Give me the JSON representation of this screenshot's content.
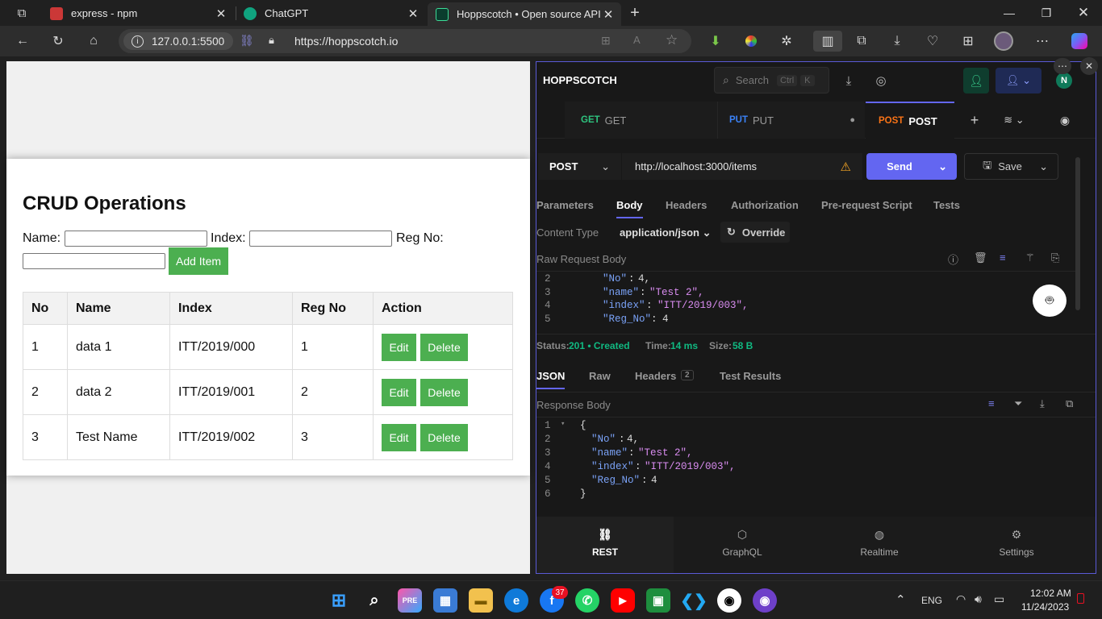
{
  "browser": {
    "tabs": [
      {
        "title": "express - npm"
      },
      {
        "title": "ChatGPT"
      },
      {
        "title": "Hoppscotch • Open source API d"
      }
    ],
    "local_address": "127.0.0.1:5500",
    "url": "https://hoppscotch.io"
  },
  "app": {
    "title": "CRUD Operations",
    "name_label": "Name:",
    "index_label": "Index:",
    "regno_label": "Reg No:",
    "add_button": "Add Item",
    "columns": [
      "No",
      "Name",
      "Index",
      "Reg No",
      "Action"
    ],
    "rows": [
      {
        "no": "1",
        "name": "data 1",
        "index": "ITT/2019/000",
        "reg": "1"
      },
      {
        "no": "2",
        "name": "data 2",
        "index": "ITT/2019/001",
        "reg": "2"
      },
      {
        "no": "3",
        "name": "Test Name",
        "index": "ITT/2019/002",
        "reg": "3"
      }
    ],
    "edit_label": "Edit",
    "delete_label": "Delete"
  },
  "hoppscotch": {
    "brand": "HOPPSCOTCH",
    "search_placeholder": "Search",
    "kbd1": "Ctrl",
    "kbd2": "K",
    "avatar": "N",
    "tabs": [
      {
        "method": "GET",
        "name": "GET",
        "color": "#2ec27e"
      },
      {
        "method": "PUT",
        "name": "PUT",
        "color": "#3b82f6"
      },
      {
        "method": "POST",
        "name": "POST",
        "color": "#f97316"
      }
    ],
    "method": "POST",
    "request_url": "http://localhost:3000/items",
    "send": "Send",
    "save": "Save",
    "req_tabs": [
      "Parameters",
      "Body",
      "Headers",
      "Authorization",
      "Pre-request Script",
      "Tests"
    ],
    "content_type_label": "Content Type",
    "content_type": "application/json",
    "override": "Override",
    "raw_request_body": "Raw Request Body",
    "request_lines": [
      {
        "n": "2",
        "key": "\"No\"",
        "val": "4,"
      },
      {
        "n": "3",
        "key": "\"name\"",
        "val": "\"Test 2\","
      },
      {
        "n": "4",
        "key": "\"index\"",
        "val": "\"ITT/2019/003\","
      },
      {
        "n": "5",
        "key": "\"Reg_No\"",
        "val": "4"
      }
    ],
    "status_label": "Status:",
    "status_value": "201 • Created",
    "time_label": "Time:",
    "time_value": "14 ms",
    "size_label": "Size:",
    "size_value": "58 B",
    "res_tabs": [
      "JSON",
      "Raw",
      "Headers",
      "Test Results"
    ],
    "headers_count": "2",
    "response_body": "Response Body",
    "response_lines": [
      {
        "n": "1",
        "text": "{"
      },
      {
        "n": "2",
        "key": "\"No\"",
        "val": "4,"
      },
      {
        "n": "3",
        "key": "\"name\"",
        "val": "\"Test 2\","
      },
      {
        "n": "4",
        "key": "\"index\"",
        "val": "\"ITT/2019/003\","
      },
      {
        "n": "5",
        "key": "\"Reg_No\"",
        "val": "4"
      },
      {
        "n": "6",
        "text": "}"
      }
    ],
    "nav": [
      "REST",
      "GraphQL",
      "Realtime",
      "Settings"
    ],
    "colors": {
      "accent": "#6366f1",
      "green": "#10b981"
    }
  },
  "taskbar": {
    "badge": "37",
    "lang": "ENG",
    "time": "12:02 AM",
    "date": "11/24/2023"
  }
}
